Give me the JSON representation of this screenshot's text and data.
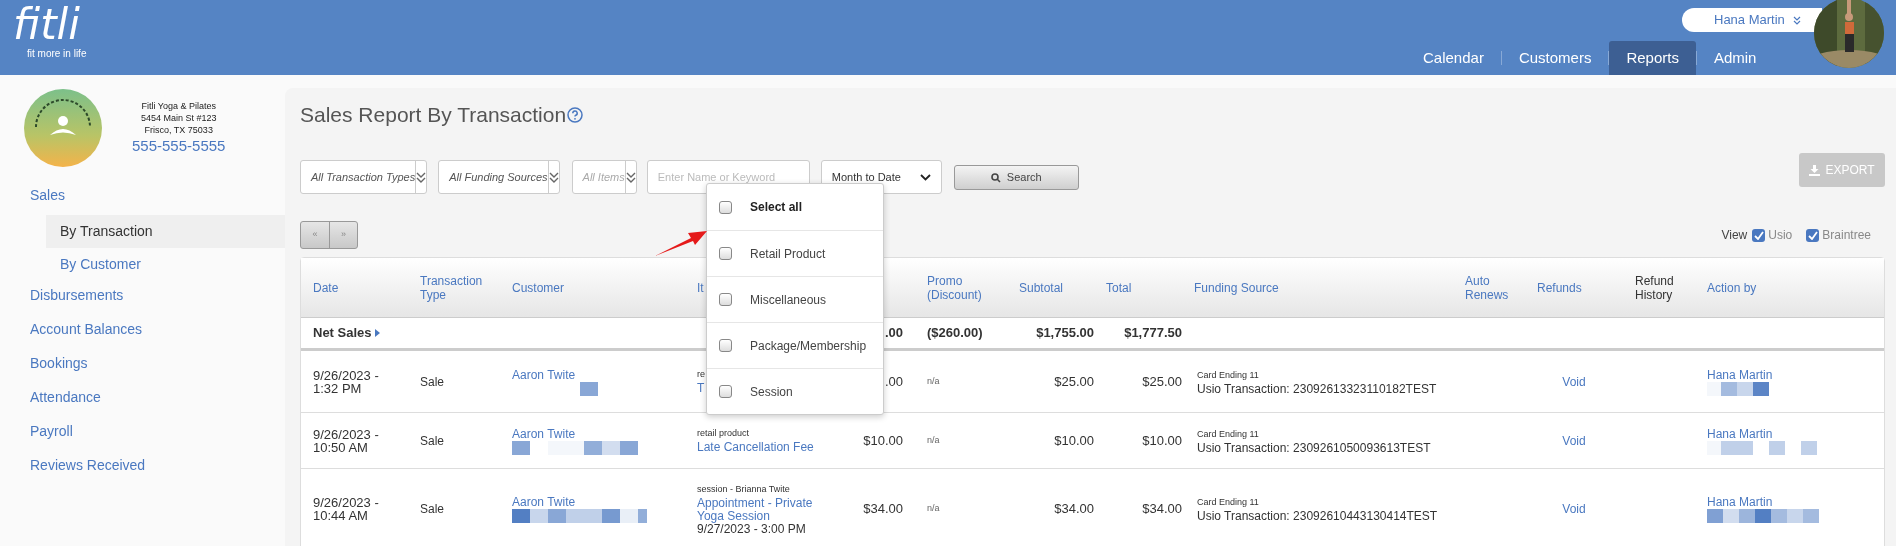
{
  "header": {
    "logo_text": "fitli",
    "tagline": "fit more in life",
    "user_name": "Hana Martin",
    "nav": [
      {
        "label": "Calendar",
        "selected": false
      },
      {
        "label": "Customers",
        "selected": false
      },
      {
        "label": "Reports",
        "selected": true
      },
      {
        "label": "Admin",
        "selected": false
      }
    ]
  },
  "business": {
    "name": "Fitli Yoga & Pilates",
    "address": "5454 Main St #123",
    "city": "Frisco, TX 75033",
    "phone": "555-555-5555"
  },
  "sidebar": {
    "items": [
      {
        "label": "Sales",
        "selected": false,
        "children": [
          {
            "label": "By Transaction",
            "selected": true
          },
          {
            "label": "By Customer",
            "selected": false
          }
        ]
      },
      {
        "label": "Disbursements",
        "selected": false
      },
      {
        "label": "Account Balances",
        "selected": false
      },
      {
        "label": "Bookings",
        "selected": false
      },
      {
        "label": "Attendance",
        "selected": false
      },
      {
        "label": "Payroll",
        "selected": false
      },
      {
        "label": "Reviews Received",
        "selected": false
      }
    ]
  },
  "title": "Sales Report By Transaction",
  "filters": {
    "transaction_types": "All Transaction Types",
    "funding_sources": "All Funding Sources",
    "items": {
      "placeholder": "All Items"
    },
    "keyword": {
      "placeholder": "Enter Name or Keyword"
    },
    "period": "Month to Date",
    "search": "Search",
    "export": {
      "label": "EXPORT",
      "disabled": true
    }
  },
  "pager": [
    "«",
    "»"
  ],
  "view": {
    "label": "View",
    "options": [
      {
        "label": "Usio",
        "checked": true
      },
      {
        "label": "Braintree",
        "checked": true
      }
    ]
  },
  "table": {
    "columns": [
      {
        "label": "Date",
        "sortable": true
      },
      {
        "label": "Transaction Type",
        "sortable": true
      },
      {
        "label": "Customer",
        "sortable": true
      },
      {
        "label": "It",
        "sortable": true
      },
      {
        "label": "Promo (Discount)",
        "sortable": true
      },
      {
        "label": "Subtotal",
        "sortable": true
      },
      {
        "label": "Total",
        "sortable": true
      },
      {
        "label": "Funding Source",
        "sortable": true
      },
      {
        "label": "Auto Renews",
        "sortable": true
      },
      {
        "label": "Refunds",
        "sortable": true
      },
      {
        "label": "Refund History",
        "sortable": false
      },
      {
        "label": "Action by",
        "sortable": true
      }
    ],
    "net_sales": {
      "label": "Net Sales",
      "price": ".00",
      "promo": "($260.00)",
      "subtotal": "$1,755.00",
      "total": "$1,777.50"
    },
    "rows": [
      {
        "date": "9/26/2023 - 1:32 PM",
        "type": "Sale",
        "customer": "Aaron Twite",
        "item_note": "re",
        "item": "T",
        "price": ".00",
        "promo": "n/a",
        "subtotal": "$25.00",
        "total": "$25.00",
        "card": "Card Ending 11",
        "transaction": "Usio Transaction: 23092613323110182TEST",
        "refund": "Void",
        "action_by": "Hana Martin"
      },
      {
        "date": "9/26/2023 - 10:50 AM",
        "type": "Sale",
        "customer": "Aaron Twite",
        "item_note": "retail product",
        "item": "Late Cancellation Fee",
        "price": "$10.00",
        "promo": "n/a",
        "subtotal": "$10.00",
        "total": "$10.00",
        "card": "Card Ending 11",
        "transaction": "Usio Transaction: 2309261050093613TEST",
        "refund": "Void",
        "action_by": "Hana Martin"
      },
      {
        "date": "9/26/2023 - 10:44 AM",
        "type": "Sale",
        "customer": "Aaron Twite",
        "item_note": "session - Brianna Twite",
        "item": "Appointment - Private Yoga Session",
        "item_extra": "9/27/2023 - 3:00 PM",
        "price": "$34.00",
        "promo": "n/a",
        "subtotal": "$34.00",
        "total": "$34.00",
        "card": "Card Ending 11",
        "transaction": "Usio Transaction: 23092610443130414TEST",
        "refund": "Void",
        "action_by": "Hana Martin"
      }
    ]
  },
  "items_menu": [
    {
      "kind": "select_all",
      "label": "Select all",
      "checked": false
    },
    {
      "kind": "option",
      "label": "Retail Product",
      "checked": false
    },
    {
      "kind": "option",
      "label": "Miscellaneous",
      "checked": false
    },
    {
      "kind": "option",
      "label": "Package/Membership",
      "checked": false
    },
    {
      "kind": "option",
      "label": "Session",
      "checked": false
    }
  ]
}
